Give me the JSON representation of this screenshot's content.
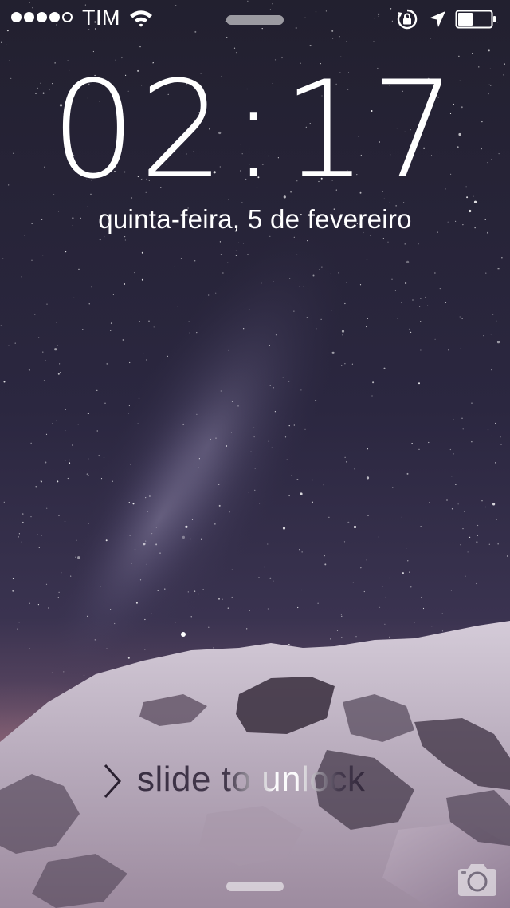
{
  "status_bar": {
    "signal_bars_filled": 4,
    "signal_bars_total": 5,
    "carrier": "TIM",
    "icons": [
      "wifi-icon",
      "orientation-lock-icon",
      "location-arrow-icon",
      "battery-icon"
    ],
    "battery_level": 0.45
  },
  "lock_screen": {
    "time_hours": "02",
    "time_separator": ":",
    "time_minutes": "17",
    "date": "quinta-feira, 5 de fevereiro",
    "slide_label": "slide to unlock"
  },
  "colors": {
    "text": "#ffffff",
    "sky_top": "#232033",
    "sky_mid": "#2e2a44",
    "horizon_glow": "#a9708a",
    "snow": "#c9bfd0"
  },
  "controls": {
    "camera_icon": "camera-icon",
    "grabber_icon": "handle-bar"
  }
}
